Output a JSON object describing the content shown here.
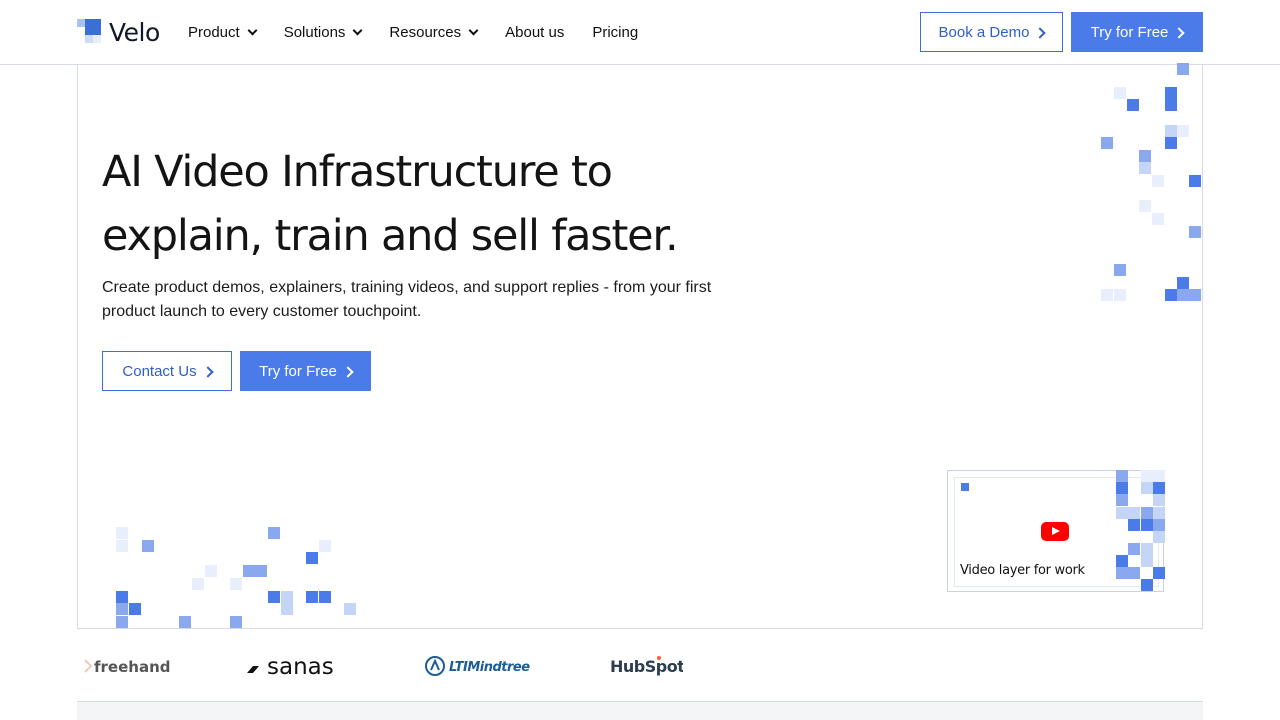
{
  "brand": {
    "name": "Velo",
    "accent": "#4b7be8",
    "accent_light": "#a9c0f3"
  },
  "nav": {
    "items": [
      {
        "label": "Product",
        "has_dropdown": true
      },
      {
        "label": "Solutions",
        "has_dropdown": true
      },
      {
        "label": "Resources",
        "has_dropdown": true
      },
      {
        "label": "About us",
        "has_dropdown": false
      },
      {
        "label": "Pricing",
        "has_dropdown": false
      }
    ],
    "book_demo": "Book a Demo",
    "try_free": "Try for Free"
  },
  "hero": {
    "title_line1": "AI Video Infrastructure to",
    "title_line2": "explain, train and sell faster.",
    "subtitle": "Create product demos, explainers, training videos, and support replies - from your first product launch to every customer touchpoint.",
    "contact_button": "Contact Us",
    "try_button": "Try for Free"
  },
  "video_card": {
    "label": "Video layer for work",
    "play_icon": "youtube-play-icon"
  },
  "customer_logos": [
    {
      "name": "freehand"
    },
    {
      "name": "sanas"
    },
    {
      "name": "LTIMindtree"
    },
    {
      "name": "HubSpot"
    }
  ]
}
